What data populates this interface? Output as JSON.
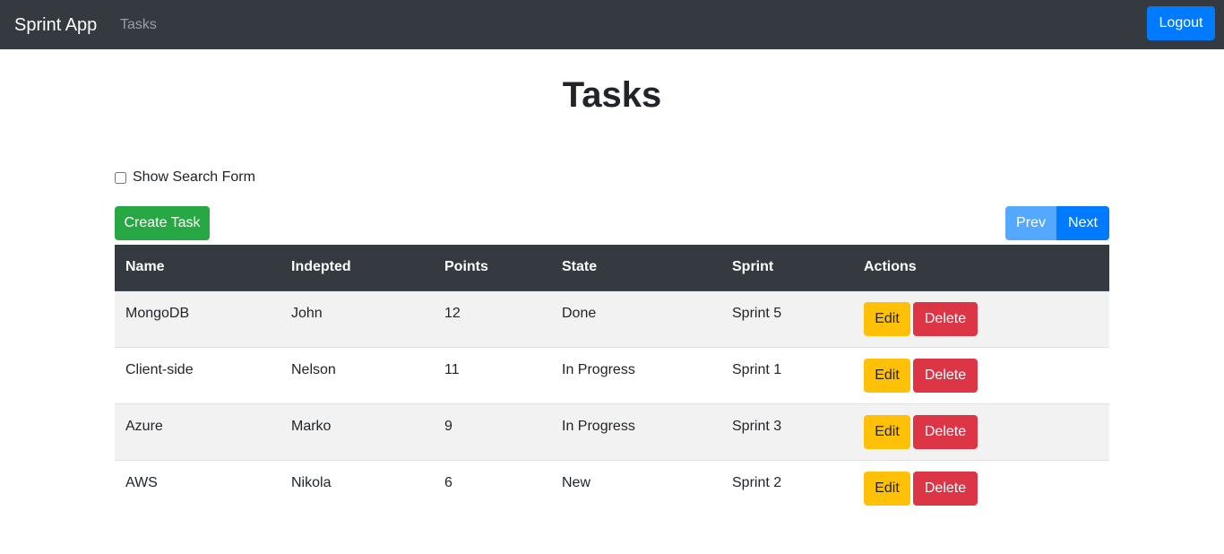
{
  "navbar": {
    "brand": "Sprint App",
    "link": "Tasks",
    "logout_label": "Logout"
  },
  "page": {
    "title": "Tasks",
    "show_search_label": "Show Search Form",
    "create_label": "Create Task",
    "prev_label": "Prev",
    "next_label": "Next"
  },
  "table": {
    "headers": [
      "Name",
      "Indepted",
      "Points",
      "State",
      "Sprint",
      "Actions"
    ],
    "rows": [
      {
        "name": "MongoDB",
        "indepted": "John",
        "points": "12",
        "state": "Done",
        "sprint": "Sprint 5"
      },
      {
        "name": "Client-side",
        "indepted": "Nelson",
        "points": "11",
        "state": "In Progress",
        "sprint": "Sprint 1"
      },
      {
        "name": "Azure",
        "indepted": "Marko",
        "points": "9",
        "state": "In Progress",
        "sprint": "Sprint 3"
      },
      {
        "name": "AWS",
        "indepted": "Nikola",
        "points": "6",
        "state": "New",
        "sprint": "Sprint 2"
      }
    ],
    "edit_label": "Edit",
    "delete_label": "Delete"
  },
  "colors": {
    "navbar": "#343a40",
    "primary": "#007bff",
    "success": "#28a745",
    "warning": "#ffc107",
    "danger": "#dc3545"
  }
}
